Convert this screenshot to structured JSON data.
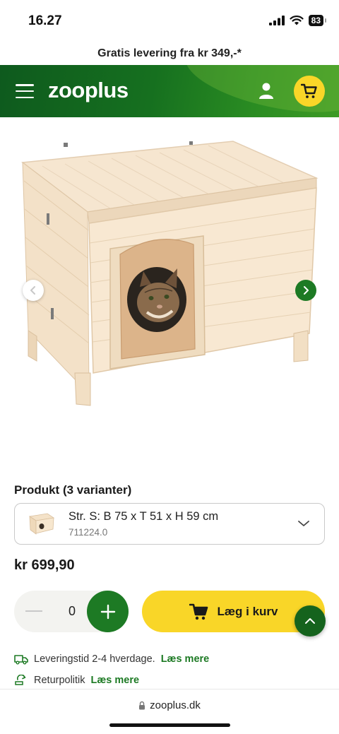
{
  "status_bar": {
    "time": "16.27",
    "battery": "83"
  },
  "promo_banner": "Gratis levering fra kr 349,-*",
  "header": {
    "logo": "zooplus",
    "menu_icon": "hamburger-menu-icon",
    "user_icon": "user-icon",
    "cart_icon": "cart-icon",
    "colors": {
      "brand_green": "#16701f",
      "cart_yellow": "#f9d628"
    }
  },
  "gallery": {
    "image_alt": "Wooden cat house with a cat looking out of the round door",
    "prev_icon": "chevron-left-icon",
    "next_icon": "chevron-right-icon"
  },
  "product": {
    "variant_heading": "Produkt (3 varianter)",
    "selected_variant": {
      "name": "Str. S: B 75 x T 51 x H 59 cm",
      "sku": "711224.0"
    },
    "price": "kr 699,90"
  },
  "purchase": {
    "quantity": "0",
    "add_to_cart_label": "Læg i kurv"
  },
  "info": {
    "delivery_text": "Leveringstid 2-4 hverdage.",
    "delivery_link": "Læs mere",
    "return_text": "Returpolitik",
    "return_link": "Læs mere"
  },
  "browser": {
    "url": "zooplus.dk"
  }
}
